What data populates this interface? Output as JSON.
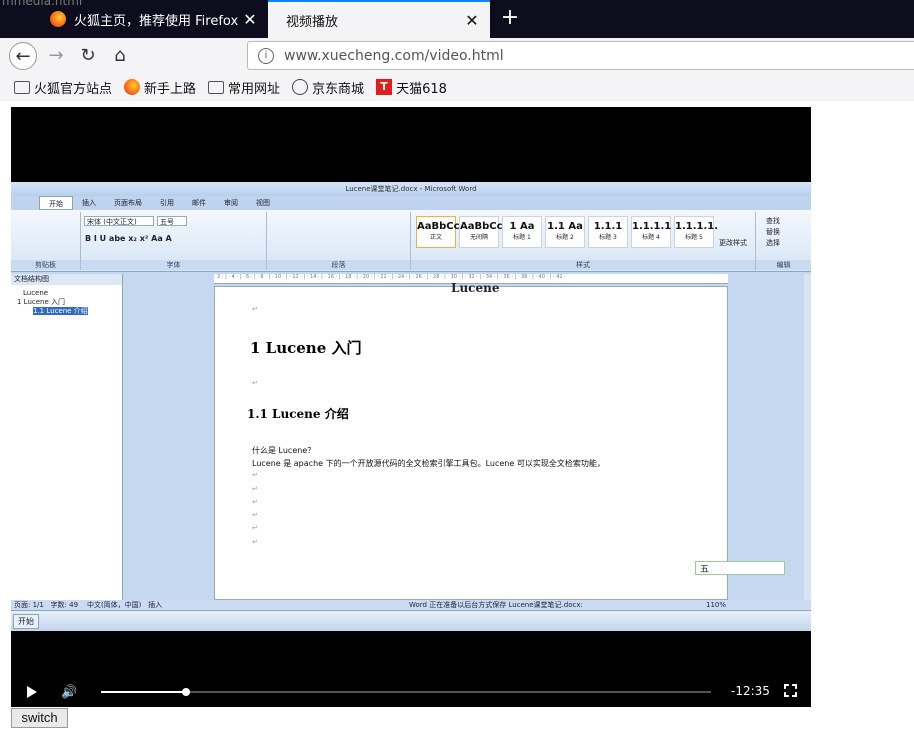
{
  "window": {
    "overlay_fragment": "mmedia.html"
  },
  "tabs": [
    {
      "title": "火狐主页，推荐使用 Firefox 火",
      "active": false
    },
    {
      "title": "视频播放",
      "active": true
    }
  ],
  "nav": {
    "url": "www.xuecheng.com/video.html"
  },
  "bookmarks": [
    "火狐官方站点",
    "新手上路",
    "常用网址",
    "京东商城",
    "天猫618"
  ],
  "tmall_glyph": "T",
  "video": {
    "time_remaining": "-12:35",
    "progress_fraction": 0.14,
    "word": {
      "window_title": "Lucene课堂笔记.docx - Microsoft Word",
      "ribbon_tabs": [
        "开始",
        "插入",
        "页面布局",
        "引用",
        "邮件",
        "审阅",
        "视图"
      ],
      "font_name": "宋体 (中文正文)",
      "font_size": "五号",
      "group_labels": [
        "剪贴板",
        "字体",
        "段落",
        "样式",
        "编辑"
      ],
      "styles": [
        {
          "sample": "AaBbCcDd",
          "name": "正文"
        },
        {
          "sample": "AaBbCcDd",
          "name": "无间隔"
        },
        {
          "sample": "1 Aa",
          "name": "标题 1"
        },
        {
          "sample": "1.1 Aa",
          "name": "标题 2"
        },
        {
          "sample": "1.1.1",
          "name": "标题 3"
        },
        {
          "sample": "1.1.1.1",
          "name": "标题 4"
        },
        {
          "sample": "1.1.1.1.",
          "name": "标题 5"
        }
      ],
      "change_styles": "更改样式",
      "edit_items": [
        "查找",
        "替换",
        "选择"
      ],
      "doc_map_title": "文档结构图",
      "doc_map_items": [
        "Lucene",
        "1 Lucene 入门",
        "1.1 Lucene 介绍"
      ],
      "top_cut_text": "Lucene",
      "heading1": "1  Lucene 入门",
      "heading2": "1.1 Lucene 介绍",
      "line1": "什么是 Lucene？",
      "line2": "Lucene 是 apache 下的一个开放源代码的全文检索引擎工具包。Lucene 可以实现全文检索功能，",
      "status": {
        "page": "页面: 1/1",
        "words": "字数: 49",
        "lang": "中文(简体，中国)",
        "mode": "插入",
        "saving": "Word 正在准备以后台方式保存 Lucene课堂笔记.docx:",
        "zoom": "110%"
      },
      "start_label": "开始",
      "ime_label": "五"
    }
  },
  "switch_label": "switch"
}
